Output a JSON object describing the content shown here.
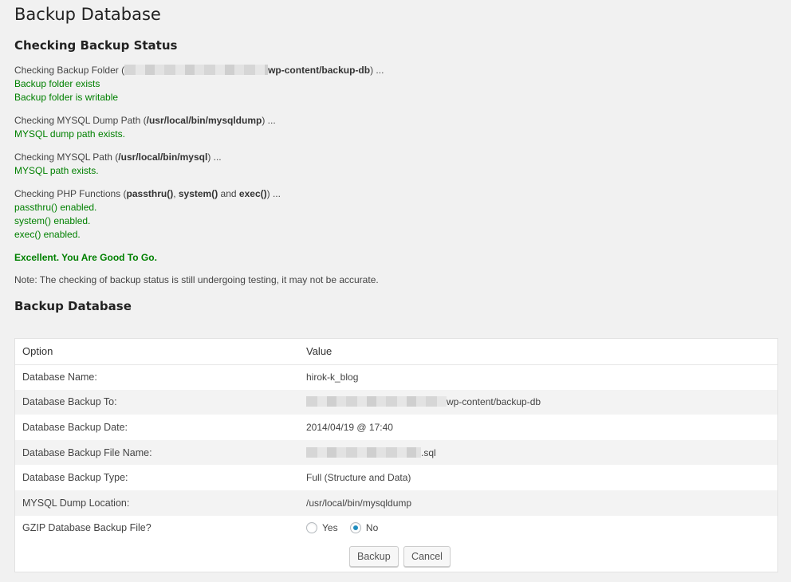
{
  "page_title": "Backup Database",
  "status_section": {
    "heading": "Checking Backup Status",
    "folder": {
      "prefix": "Checking Backup Folder (",
      "path_suffix": "wp-content/backup-db",
      "suffix": ") ...",
      "results": [
        "Backup folder exists",
        "Backup folder is writable"
      ]
    },
    "mysqldump": {
      "prefix": "Checking MYSQL Dump Path (",
      "path": "/usr/local/bin/mysqldump",
      "suffix": ") ...",
      "results": [
        "MYSQL dump path exists."
      ]
    },
    "mysql": {
      "prefix": "Checking MYSQL Path (",
      "path": "/usr/local/bin/mysql",
      "suffix": ") ...",
      "results": [
        "MYSQL path exists."
      ]
    },
    "php": {
      "prefix": "Checking PHP Functions (",
      "f1": "passthru()",
      "sep1": ", ",
      "f2": "system()",
      "sep2": " and ",
      "f3": "exec()",
      "suffix": ") ...",
      "results": [
        "passthru() enabled.",
        "system() enabled.",
        "exec() enabled."
      ]
    },
    "verdict": "Excellent. You Are Good To Go.",
    "note": "Note: The checking of backup status is still undergoing testing, it may not be accurate."
  },
  "backup_section": {
    "heading": "Backup Database",
    "table": {
      "col_option": "Option",
      "col_value": "Value",
      "rows": [
        {
          "option": "Database Name:",
          "value": "hirok-k_blog"
        },
        {
          "option": "Database Backup To:",
          "value": "wp-content/backup-db"
        },
        {
          "option": "Database Backup Date:",
          "value": "2014/04/19 @ 17:40"
        },
        {
          "option": "Database Backup File Name:",
          "value": ".sql"
        },
        {
          "option": "Database Backup Type:",
          "value": "Full (Structure and Data)"
        },
        {
          "option": "MYSQL Dump Location:",
          "value": "/usr/local/bin/mysqldump"
        },
        {
          "option": "GZIP Database Backup File?",
          "value": ""
        }
      ]
    },
    "gzip": {
      "yes_label": "Yes",
      "no_label": "No",
      "selected": "No"
    },
    "buttons": {
      "backup": "Backup",
      "cancel": "Cancel"
    }
  },
  "colors": {
    "success": "#008000",
    "radio_accent": "#1e8cbe"
  }
}
